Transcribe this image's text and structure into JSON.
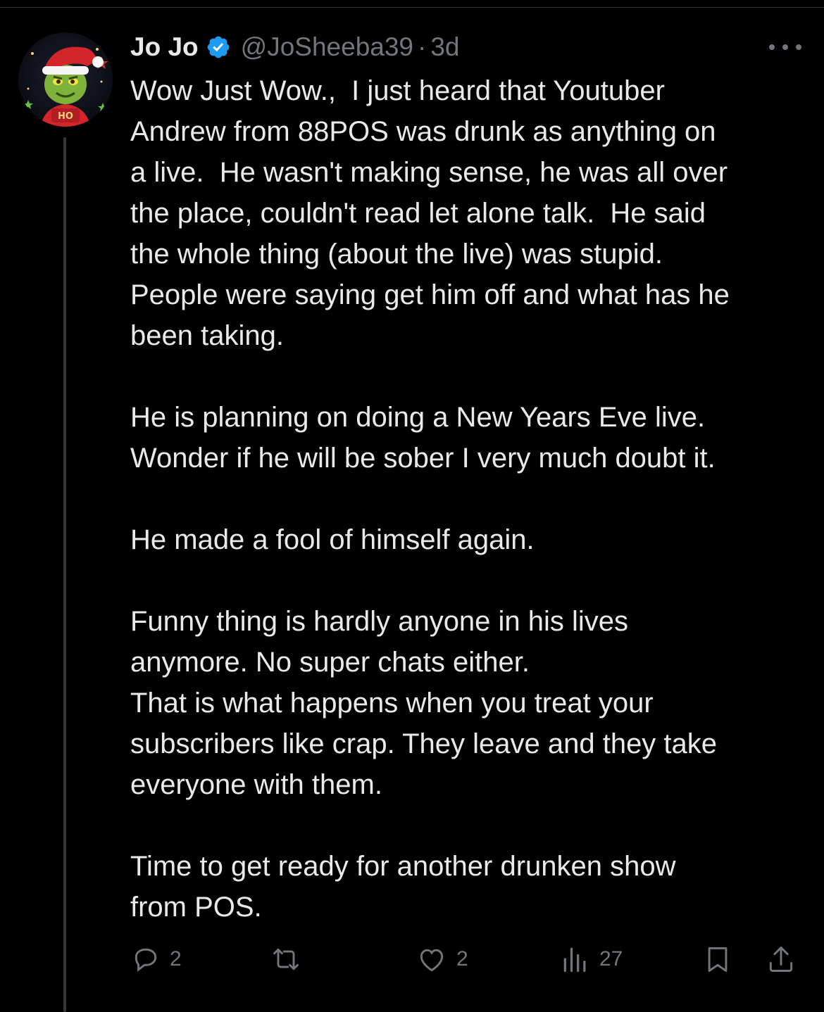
{
  "tweet": {
    "author_name": "Jo Jo",
    "handle": "@JoSheeba39",
    "separator": "·",
    "time": "3d",
    "avatar_label": "HO",
    "body_lines": [
      "Wow Just Wow.,  I just heard that Youtuber",
      "Andrew from 88POS was drunk as anything on",
      "a live.  He wasn't making sense, he was all over",
      "the place, couldn't read let alone talk.  He said",
      "the whole thing (about the live) was stupid.",
      "People were saying get him off and what has he",
      "been taking.",
      "",
      "He is planning on doing a New Years Eve live.",
      "Wonder if he will be sober I very much doubt it.",
      "",
      "He made a fool of himself again.",
      "",
      "Funny thing is hardly anyone in his lives",
      "anymore. No super chats either.",
      "That is what happens when you treat your",
      "subscribers like crap. They leave and they take",
      "everyone with them.",
      "",
      "Time to get ready for another drunken show",
      "from POS."
    ]
  },
  "actions": {
    "replies": "2",
    "likes": "2",
    "views": "27"
  },
  "colors": {
    "background": "#000000",
    "text": "#e7e9ea",
    "muted": "#71767b",
    "verified": "#1d9bf0"
  },
  "icons": [
    "verified-badge-icon",
    "more-icon",
    "reply-icon",
    "retweet-icon",
    "like-icon",
    "views-icon",
    "bookmark-icon",
    "share-icon"
  ]
}
